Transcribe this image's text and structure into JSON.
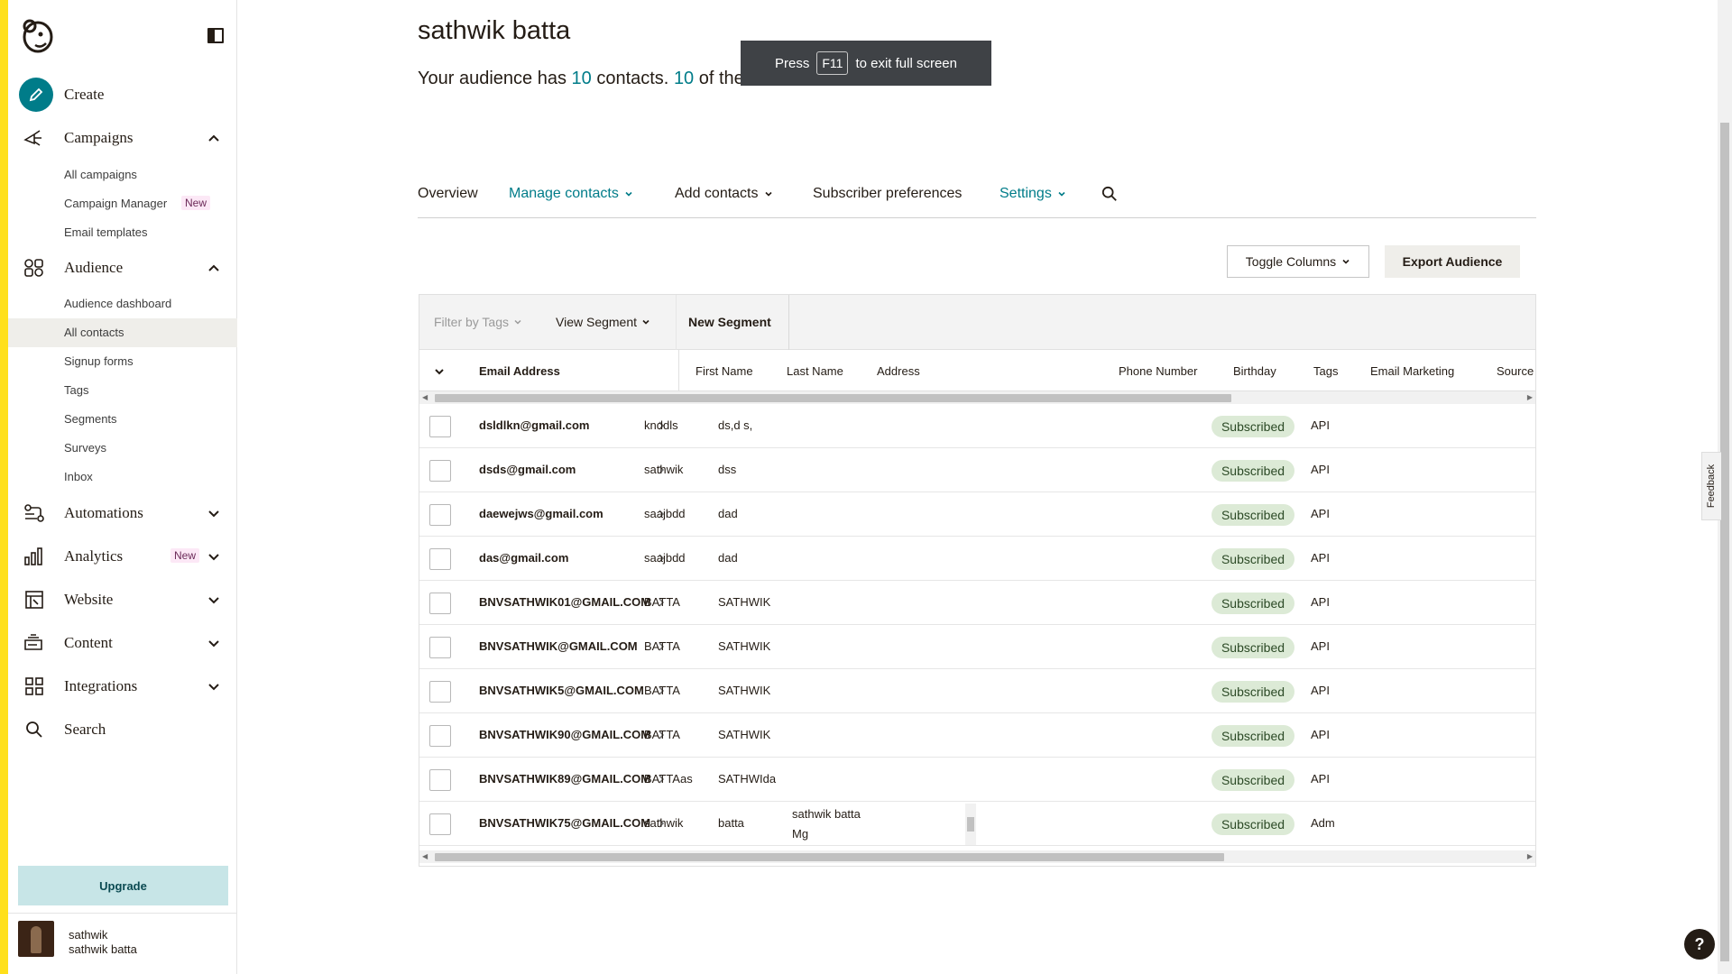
{
  "sidebar": {
    "create_label": "Create",
    "campaigns_label": "Campaigns",
    "campaigns_sub": {
      "all": "All campaigns",
      "manager": "Campaign Manager",
      "manager_badge": "New",
      "templates": "Email templates"
    },
    "audience_label": "Audience",
    "audience_sub": {
      "dashboard": "Audience dashboard",
      "all_contacts": "All contacts",
      "signup_forms": "Signup forms",
      "tags": "Tags",
      "segments": "Segments",
      "surveys": "Surveys",
      "inbox": "Inbox"
    },
    "automations_label": "Automations",
    "analytics_label": "Analytics",
    "analytics_badge": "New",
    "website_label": "Website",
    "content_label": "Content",
    "integrations_label": "Integrations",
    "search_label": "Search",
    "upgrade_label": "Upgrade",
    "profile": {
      "name": "sathwik",
      "account": "sathwik batta"
    }
  },
  "header": {
    "title": "sathwik batta",
    "summary_prefix": "Your audience has",
    "contacts_count": "10",
    "summary_mid": "contacts.",
    "subscribers_count": "10",
    "summary_suffix": "of these are subscribers."
  },
  "fullscreen_toast": {
    "before": "Press",
    "key": "F11",
    "after": "to exit full screen"
  },
  "tabs": {
    "overview": "Overview",
    "manage_contacts": "Manage contacts",
    "add_contacts": "Add contacts",
    "subscriber_preferences": "Subscriber preferences",
    "settings": "Settings"
  },
  "actions": {
    "toggle_columns": "Toggle Columns",
    "export_audience": "Export Audience"
  },
  "filters": {
    "filter_by_tags": "Filter by Tags",
    "view_segment": "View Segment",
    "new_segment": "New Segment"
  },
  "columns": {
    "email": "Email Address",
    "first_name": "First Name",
    "last_name": "Last Name",
    "address": "Address",
    "phone": "Phone Number",
    "birthday": "Birthday",
    "tags": "Tags",
    "email_marketing": "Email Marketing",
    "source": "Source"
  },
  "rows": [
    {
      "email": "dsldlkn@gmail.com",
      "first": "knddls",
      "last": "ds,d s,",
      "status": "Subscribed",
      "source": "API"
    },
    {
      "email": "dsds@gmail.com",
      "first": "sathwik",
      "last": "dss",
      "status": "Subscribed",
      "source": "API"
    },
    {
      "email": "daewejws@gmail.com",
      "first": "saajbdd",
      "last": "dad",
      "status": "Subscribed",
      "source": "API"
    },
    {
      "email": "das@gmail.com",
      "first": "saajbdd",
      "last": "dad",
      "status": "Subscribed",
      "source": "API"
    },
    {
      "email": "BNVSATHWIK01@GMAIL.COM",
      "first": "BATTA",
      "last": "SATHWIK",
      "status": "Subscribed",
      "source": "API"
    },
    {
      "email": "BNVSATHWIK@GMAIL.COM",
      "first": "BATTA",
      "last": "SATHWIK",
      "status": "Subscribed",
      "source": "API"
    },
    {
      "email": "BNVSATHWIK5@GMAIL.COM",
      "first": "BATTA",
      "last": "SATHWIK",
      "status": "Subscribed",
      "source": "API"
    },
    {
      "email": "BNVSATHWIK90@GMAIL.COM",
      "first": "BATTA",
      "last": "SATHWIK",
      "status": "Subscribed",
      "source": "API"
    },
    {
      "email": "BNVSATHWIK89@GMAIL.COM",
      "first": "BATTAas",
      "last": "SATHWIda",
      "status": "Subscribed",
      "source": "API"
    },
    {
      "email": "BNVSATHWIK75@GMAIL.COM",
      "first": "sathwik",
      "last": "batta",
      "status": "Subscribed",
      "source": "Adm",
      "address_line1": "sathwik batta",
      "address_line2": "Mg"
    }
  ],
  "feedback_label": "Feedback",
  "help_label": "?",
  "colors": {
    "accent": "#007c89",
    "brand_yellow": "#ffe01b",
    "subscribed_bg": "#dcead6"
  }
}
